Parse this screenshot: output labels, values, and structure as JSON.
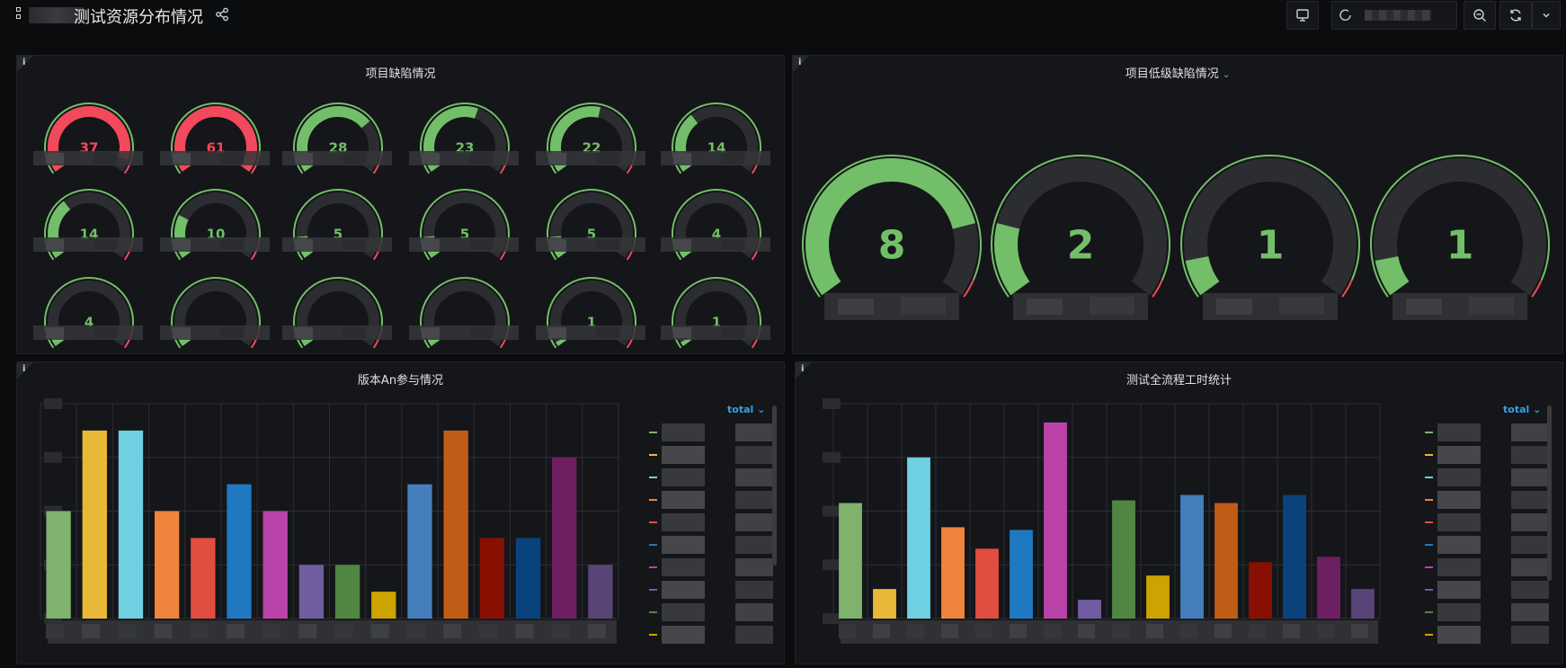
{
  "header": {
    "title": "测试资源分布情况"
  },
  "panels": {
    "defects": {
      "title": "项目缺陷情况"
    },
    "low_defects": {
      "title": "项目低级缺陷情况"
    },
    "version": {
      "title": "版本An参与情况",
      "legend_toggle": "total"
    },
    "hours": {
      "title": "测试全流程工时统计",
      "legend_toggle": "total"
    }
  },
  "colors": {
    "green": "#73bf69",
    "red": "#f2495c",
    "bg": "#141619",
    "track": "#2c2d31"
  },
  "gauges_small": {
    "values": [
      37,
      61,
      28,
      23,
      22,
      14,
      14,
      10,
      5,
      5,
      5,
      4,
      4,
      3,
      3,
      2,
      1,
      1
    ],
    "max": 40,
    "labels": [
      "37",
      "61",
      "28",
      "23",
      "22",
      "14",
      "14",
      "10",
      "5",
      "5",
      "5",
      "4",
      "4",
      "",
      "",
      "",
      "1",
      "1"
    ]
  },
  "gauges_big": {
    "values": [
      8,
      2,
      1,
      1
    ],
    "max": 10,
    "labels": [
      "8",
      "2",
      "1",
      "1"
    ]
  },
  "chart_data": [
    {
      "type": "bar",
      "title": "版本An参与情况",
      "ylim": [
        0,
        8
      ],
      "values": [
        4,
        7,
        7,
        4,
        3,
        5,
        4,
        2,
        2,
        1,
        5,
        7,
        3,
        3,
        6,
        2
      ],
      "colors": [
        "#7eb26d",
        "#eab839",
        "#6ed0e0",
        "#ef843c",
        "#e24d42",
        "#1f78c1",
        "#ba43a9",
        "#705da0",
        "#508642",
        "#cca300",
        "#447ebc",
        "#c15c17",
        "#890f02",
        "#0a437c",
        "#6d1f62",
        "#584477"
      ]
    },
    {
      "type": "bar",
      "title": "测试全流程工时统计",
      "ylim": [
        0,
        8
      ],
      "values": [
        4.3,
        1.1,
        6,
        3.4,
        2.6,
        3.3,
        7.3,
        0.7,
        4.4,
        1.6,
        4.6,
        4.3,
        2.1,
        4.6,
        2.3,
        1.1
      ],
      "colors": [
        "#7eb26d",
        "#eab839",
        "#6ed0e0",
        "#ef843c",
        "#e24d42",
        "#1f78c1",
        "#ba43a9",
        "#705da0",
        "#508642",
        "#cca300",
        "#447ebc",
        "#c15c17",
        "#890f02",
        "#0a437c",
        "#6d1f62",
        "#584477"
      ]
    }
  ]
}
